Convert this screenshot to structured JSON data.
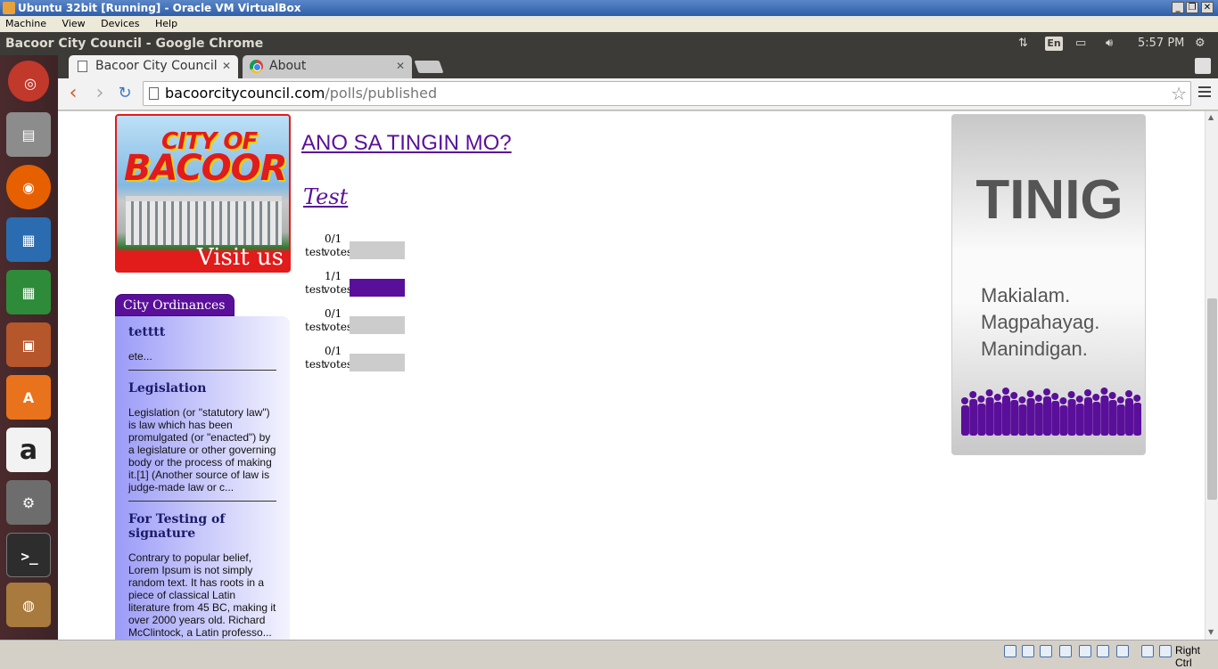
{
  "vbox": {
    "title": "Ubuntu 32bit [Running] - Oracle VM VirtualBox",
    "menu": [
      "Machine",
      "View",
      "Devices",
      "Help"
    ],
    "host_key": "Right Ctrl"
  },
  "ubuntu_panel": {
    "window_title": "Bacoor City Council - Google Chrome",
    "keyboard": "En",
    "time": "5:57 PM"
  },
  "launcher": [
    "dash-home-icon",
    "files-icon",
    "firefox-icon",
    "writer-icon",
    "calc-icon",
    "impress-icon",
    "software-center-icon",
    "amazon-icon",
    "system-settings-icon",
    "terminal-icon",
    "chrome-icon"
  ],
  "chrome": {
    "tabs": [
      {
        "label": "Bacoor City Council",
        "active": true
      },
      {
        "label": "About",
        "active": false
      }
    ],
    "url_host": "bacoorcitycouncil.com",
    "url_path": "/polls/published"
  },
  "page": {
    "banner": {
      "logo_line1": "CITY OF",
      "logo_line2": "BACOOR",
      "visit": "Visit us"
    },
    "ordinances": {
      "tab_label": "City Ordinances",
      "items": [
        {
          "title": "tetttt",
          "excerpt": "ete..."
        },
        {
          "title": "Legislation",
          "excerpt": "Legislation (or \"statutory law\") is law which has been promulgated (or \"enacted\") by a legislature or other governing body or the process of making it.[1] (Another source of law is judge-made law or c..."
        },
        {
          "title": "For Testing of signature",
          "excerpt": "Contrary to popular belief, Lorem Ipsum is not simply random text. It has roots in a piece of classical Latin literature from 45 BC, making it over 2000 years old. Richard McClintock, a Latin professo..."
        }
      ]
    },
    "poll": {
      "heading": "ANO SA TINGIN MO?",
      "question": "Test",
      "options": [
        {
          "label": "test",
          "count": "0/1",
          "votes": "votes",
          "fraction": 0
        },
        {
          "label": "test",
          "count": "1/1",
          "votes": "votes",
          "fraction": 1
        },
        {
          "label": "test",
          "count": "0/1",
          "votes": "votes",
          "fraction": 0
        },
        {
          "label": "test",
          "count": "0/1",
          "votes": "votes",
          "fraction": 0
        }
      ]
    },
    "ad": {
      "title": "TINIG",
      "lines": [
        "Makialam.",
        "Magpahayag.",
        "Manindigan."
      ],
      "accent": "#5a0f9a"
    }
  }
}
